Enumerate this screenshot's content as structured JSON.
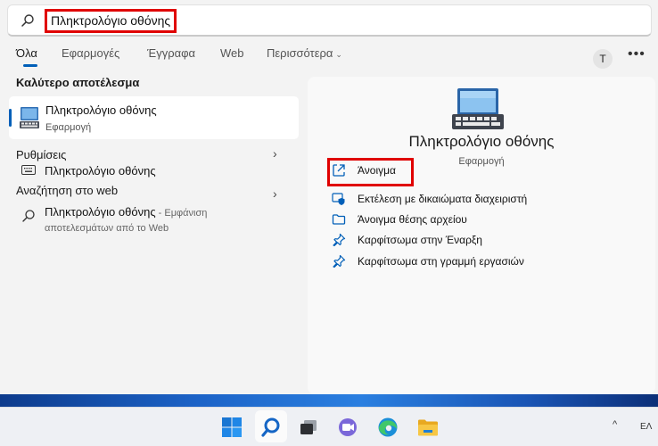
{
  "search": {
    "query": "Πληκτρολόγιο οθόνης"
  },
  "tabs": [
    {
      "label": "Όλα"
    },
    {
      "label": "Εφαρμογές"
    },
    {
      "label": "Έγγραφα"
    },
    {
      "label": "Web"
    },
    {
      "label": "Περισσότερα"
    }
  ],
  "user": {
    "initial": "T"
  },
  "overflow_label": "•••",
  "best_match": {
    "heading": "Καλύτερο αποτέλεσμα",
    "title": "Πληκτρολόγιο οθόνης",
    "subtitle": "Εφαρμογή"
  },
  "settings": {
    "heading": "Ρυθμίσεις",
    "item": "Πληκτρολόγιο οθόνης"
  },
  "web_search": {
    "heading": "Αναζήτηση στο web",
    "query": "Πληκτρολόγιο οθόνης",
    "suffix": " - Εμφάνιση",
    "suffix2": "αποτελεσμάτων από το Web"
  },
  "details": {
    "title": "Πληκτρολόγιο οθόνης",
    "subtitle": "Εφαρμογή",
    "actions": [
      {
        "label": "Άνοιγμα",
        "icon": "open-icon"
      },
      {
        "label": "Εκτέλεση με δικαιώματα διαχειριστή",
        "icon": "shield-icon"
      },
      {
        "label": "Άνοιγμα θέσης αρχείου",
        "icon": "folder-icon"
      },
      {
        "label": "Καρφίτσωμα στην Έναρξη",
        "icon": "pin-icon"
      },
      {
        "label": "Καρφίτσωμα στη γραμμή εργασιών",
        "icon": "pin-icon"
      }
    ]
  },
  "tray": {
    "chevron": "^",
    "language": "ΕΛ"
  },
  "colors": {
    "accent": "#005fb8",
    "highlight": "#e00000"
  }
}
